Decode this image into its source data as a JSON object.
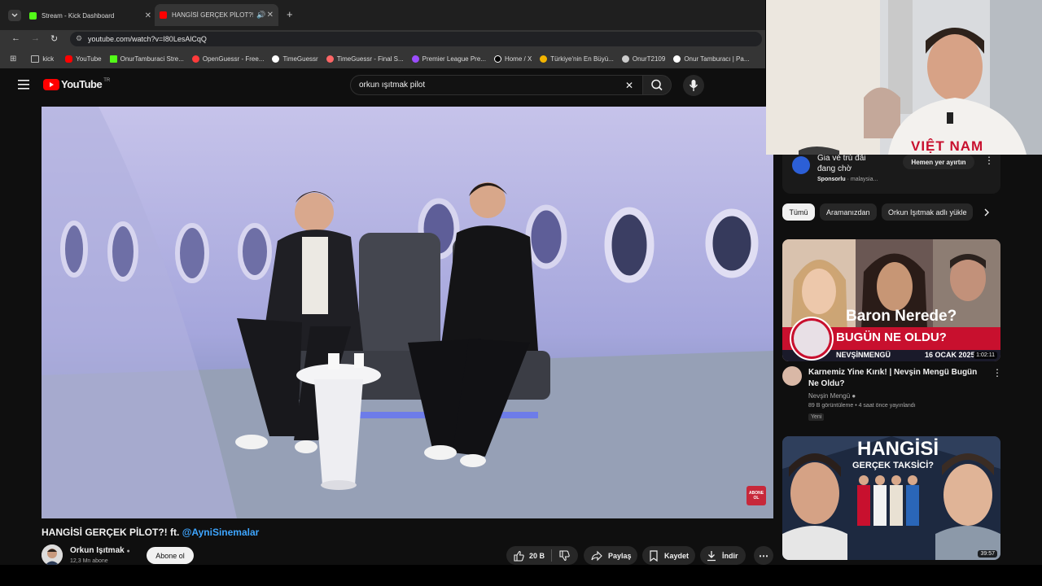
{
  "browser": {
    "tabs": [
      {
        "title": "Stream - Kick Dashboard",
        "color": "#53fc18"
      },
      {
        "title": "HANGİSİ GERÇEK PİLOT?! ft...",
        "color": "#ff0000"
      }
    ],
    "url": "youtube.com/watch?v=I80LesAlCqQ",
    "bookmarks": [
      {
        "label": "kick",
        "color": "#888888"
      },
      {
        "label": "YouTube",
        "color": "#ff0000"
      },
      {
        "label": "OnurTamburaci Stre...",
        "color": "#53fc18"
      },
      {
        "label": "OpenGuessr - Free...",
        "color": "#ff3b3b"
      },
      {
        "label": "TimeGuessr",
        "color": "#ffffff"
      },
      {
        "label": "TimeGuessr - Final S...",
        "color": "#ff6666"
      },
      {
        "label": "Premier League Pre...",
        "color": "#9b4dff"
      },
      {
        "label": "Home / X",
        "color": "#ffffff"
      },
      {
        "label": "Türkiye'nin En Büyü...",
        "color": "#f3b400"
      },
      {
        "label": "OnurT2109",
        "color": "#cccccc"
      },
      {
        "label": "Onur Tamburacı | Pa...",
        "color": "#ffffff"
      }
    ]
  },
  "youtube": {
    "logo": "YouTube",
    "region": "TR",
    "search_value": "orkun ışıtmak pilot"
  },
  "video": {
    "title_prefix": "HANGİSİ GERÇEK PİLOT?! ft.",
    "title_mention": "@AyniSinemalar",
    "watermark": "ABONE OL"
  },
  "channel": {
    "name": "Orkun Işıtmak",
    "subscribers": "12,3 Mn abone",
    "subscribe_label": "Abone ol"
  },
  "actions": {
    "likes": "20 B",
    "share": "Paylaş",
    "save": "Kaydet",
    "download": "İndir"
  },
  "ad": {
    "text_line1": "Gia vé trú đãi",
    "text_line2": "đang chờ",
    "sponsored": "Sponsorlu",
    "advertiser": "malaysia...",
    "cta": "Hemen yer ayırtın"
  },
  "chips": [
    "Tümü",
    "Aramanızdan",
    "Orkun Işıtmak adlı yükle"
  ],
  "recommendations": [
    {
      "title": "Karnemiz Yine Kırık! | Nevşin Mengü Bugün Ne Oldu?",
      "channel": "Nevşin Mengü",
      "meta": "89 B görüntüleme • 4 saat önce yayınlandı",
      "badge": "Yeni",
      "duration": "1:02:11",
      "thumb_heading": "Baron Nerede?",
      "thumb_banner": "BUGÜN NE OLDU?",
      "thumb_brand": "NEVŞİNMENGÜ",
      "thumb_date": "16 OCAK 2025"
    },
    {
      "thumb_heading": "HANGİSİ",
      "thumb_sub": "GERÇEK TAKSİCİ?",
      "duration": "39:57"
    }
  ],
  "webcam": {
    "shirt_text": "VIỆT NAM"
  }
}
